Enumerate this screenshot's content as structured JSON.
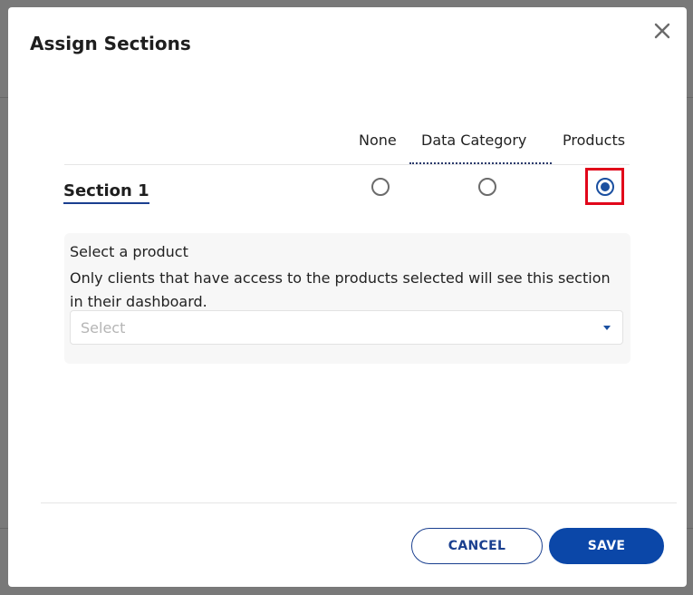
{
  "dialog": {
    "title": "Assign Sections",
    "close_icon": "close-icon"
  },
  "columns": {
    "none": "None",
    "data_category": "Data Category",
    "products": "Products"
  },
  "section": {
    "label": "Section 1",
    "selected_option": "Products"
  },
  "product_panel": {
    "title": "Select a product",
    "description": "Only clients that have access to the products selected will see this section in their dashboard.",
    "select_placeholder": "Select"
  },
  "buttons": {
    "cancel": "CANCEL",
    "save": "SAVE"
  },
  "colors": {
    "primary": "#0b47a8",
    "highlight": "#e1061a"
  }
}
